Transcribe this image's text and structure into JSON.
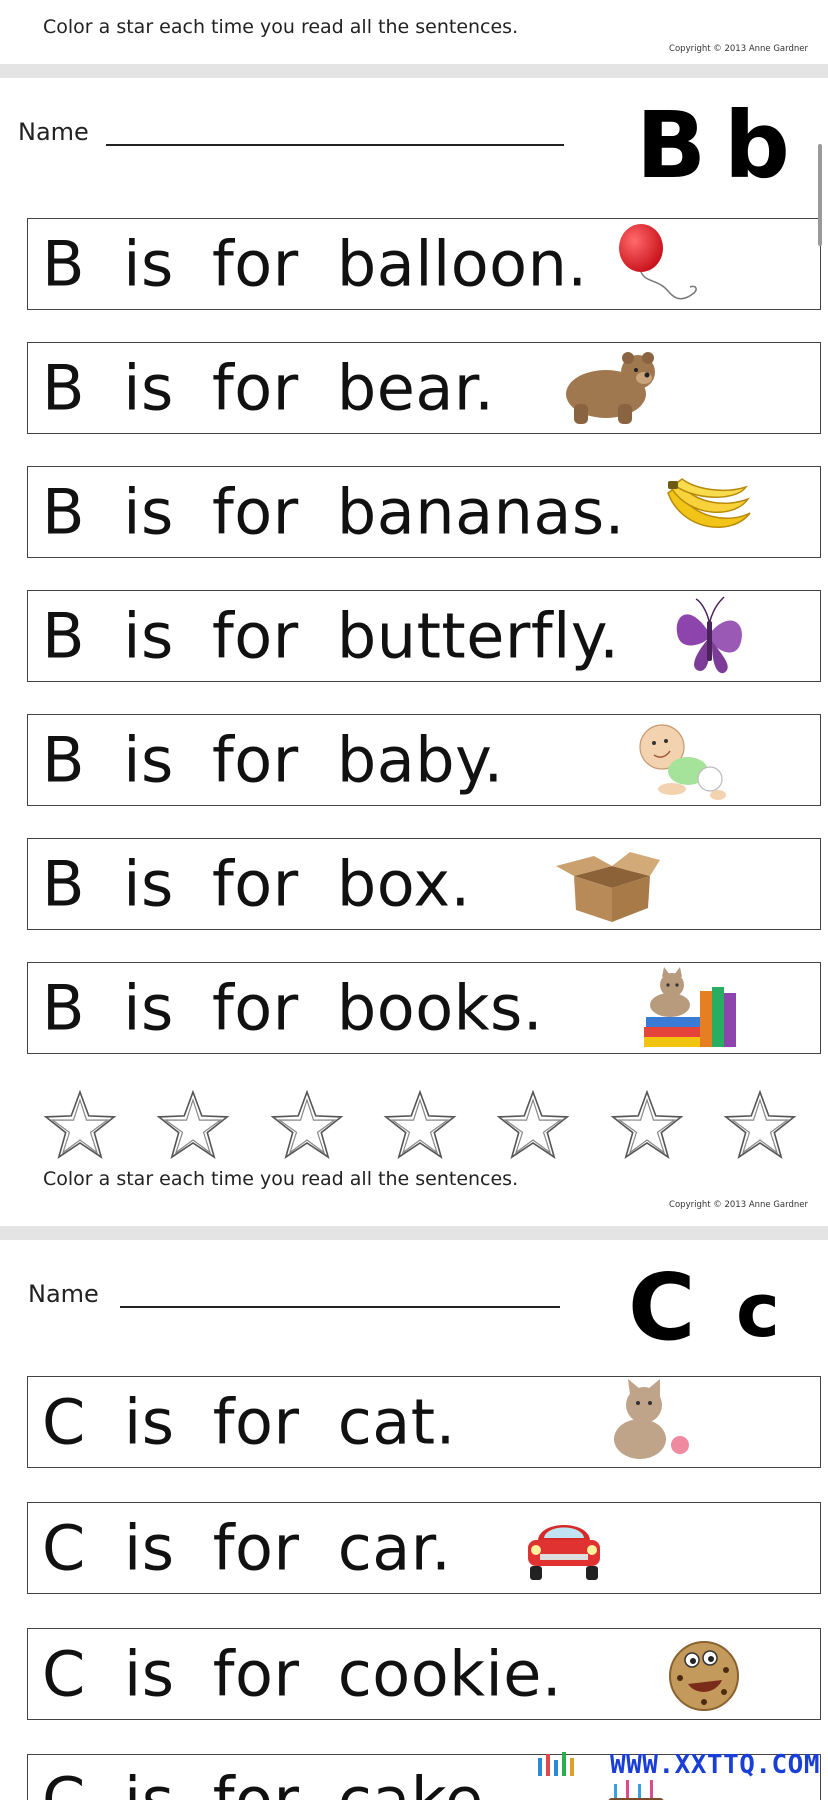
{
  "page_top": {
    "instruction": "Color a star each time you read all the sentences.",
    "copyright": "Copyright © 2013 Anne Gardner"
  },
  "page_b": {
    "name_label": "Name",
    "letter_upper": "B",
    "letter_lower": "b",
    "sentences": [
      {
        "text": "B is for balloon.",
        "icon": "balloon-icon"
      },
      {
        "text": "B is for bear.",
        "icon": "bear-icon"
      },
      {
        "text": "B is for bananas.",
        "icon": "bananas-icon"
      },
      {
        "text": "B is for butterfly.",
        "icon": "butterfly-icon"
      },
      {
        "text": "B is for baby.",
        "icon": "baby-icon"
      },
      {
        "text": "B is for box.",
        "icon": "box-icon"
      },
      {
        "text": "B is for books.",
        "icon": "books-icon"
      }
    ],
    "star_count": 7,
    "instruction": "Color a star each time you read all the sentences.",
    "copyright": "Copyright © 2013 Anne Gardner"
  },
  "page_c": {
    "name_label": "Name",
    "letter_upper": "C",
    "letter_lower": "c",
    "sentences": [
      {
        "text": "C is for cat.",
        "icon": "cat-icon"
      },
      {
        "text": "C is for car.",
        "icon": "car-icon"
      },
      {
        "text": "C is for cookie.",
        "icon": "cookie-icon"
      },
      {
        "text": "C is for cake.",
        "icon": "cake-icon"
      }
    ]
  },
  "watermark": "WWW.XXTTQ.COM"
}
